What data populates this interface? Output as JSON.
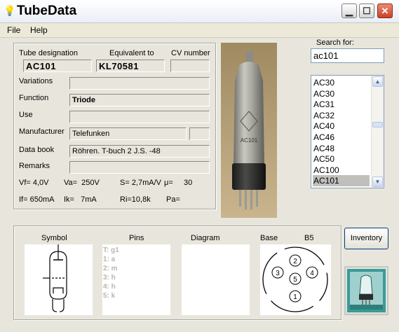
{
  "window": {
    "title": "TubeData"
  },
  "menu": {
    "file": "File",
    "help": "Help"
  },
  "search": {
    "label": "Search for:",
    "value": "ac101"
  },
  "list": {
    "items": [
      "AC30",
      "AC30",
      "AC31",
      "AC32",
      "AC40",
      "AC46",
      "AC48",
      "AC50",
      "AC100",
      "AC101"
    ],
    "selected_index": 9
  },
  "fields": {
    "designation_label": "Tube designation",
    "equivalent_label": "Equivalent to",
    "cv_label": "CV number",
    "designation": "AC101",
    "equivalent": "KL70581",
    "cv": "",
    "variations_label": "Variations",
    "variations": "",
    "function_label": "Function",
    "function": "Triode",
    "use_label": "Use",
    "use": "",
    "manufacturer_label": "Manufacturer",
    "manufacturer": "Telefunken",
    "manufacturer_extra": "",
    "databook_label": "Data book",
    "databook": "Röhren. T-buch 2 J.S. -48",
    "remarks_label": "Remarks",
    "remarks": ""
  },
  "params": {
    "vf": "Vf= 4,0V",
    "va": "Va=  250V",
    "s": "S= 2,7mA/V",
    "mu": "μ=     30",
    "if": "If= 650mA",
    "ik": "Ik=   7mA",
    "ri": "Ri=10,8k",
    "pa": "Pa="
  },
  "tube_photo": {
    "marking": "AC101"
  },
  "bottom": {
    "symbol_label": "Symbol",
    "pins_label": "Pins",
    "diagram_label": "Diagram",
    "base_label": "Base",
    "base_value": "B5",
    "pins": [
      "T: g1",
      "1: a",
      "2: m",
      "3: h",
      "4: h",
      "5: k"
    ],
    "base_pins": [
      "1",
      "2",
      "3",
      "4",
      "5"
    ]
  },
  "inventory_button": "Inventory",
  "colors": {
    "selection": "#c0bfbb",
    "window_bg": "#e8e6dc",
    "close_button": "#c8422a"
  }
}
